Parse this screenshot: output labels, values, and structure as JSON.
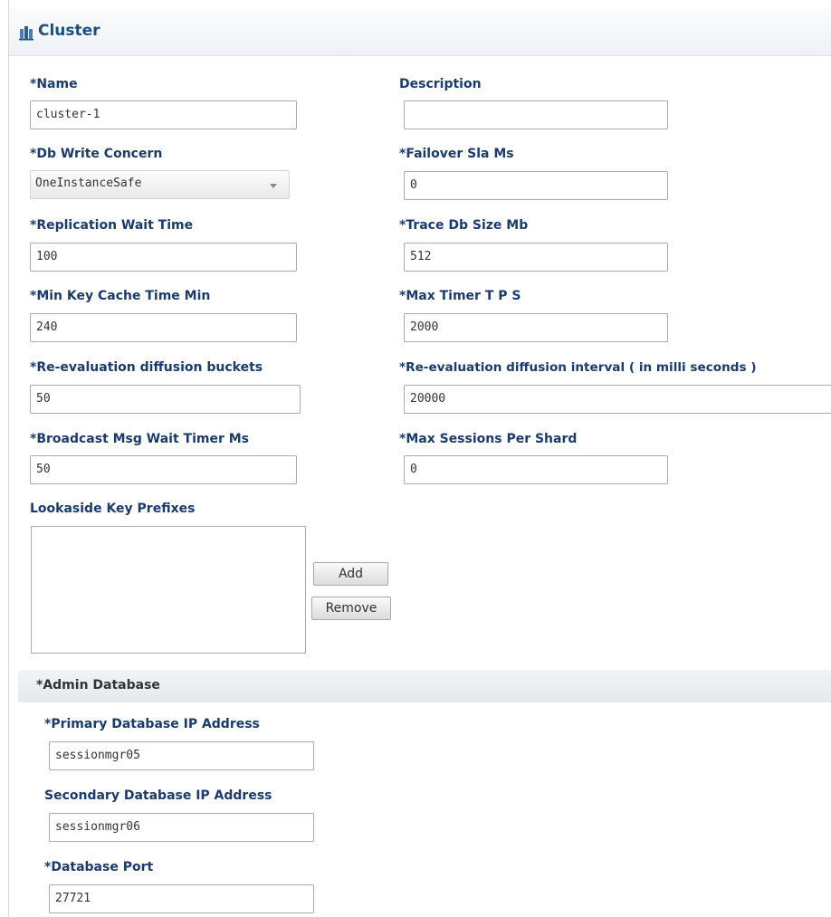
{
  "header": {
    "title": "Cluster"
  },
  "fields": {
    "name": {
      "label": "*Name",
      "value": "cluster-1"
    },
    "description": {
      "label": "Description",
      "value": ""
    },
    "db_write_concern": {
      "label": "*Db Write Concern",
      "value": "OneInstanceSafe"
    },
    "failover_sla_ms": {
      "label": "*Failover Sla Ms",
      "value": "0"
    },
    "replication_wait_time": {
      "label": "*Replication Wait Time",
      "value": "100"
    },
    "trace_db_size_mb": {
      "label": "*Trace Db Size Mb",
      "value": "512"
    },
    "min_key_cache_time_min": {
      "label": "*Min Key Cache Time Min",
      "value": "240"
    },
    "max_timer_tps": {
      "label": "*Max Timer T P S",
      "value": "2000"
    },
    "reeval_diffusion_buckets": {
      "label": "*Re-evaluation diffusion buckets",
      "value": "50"
    },
    "reeval_diffusion_interval": {
      "label": "*Re-evaluation diffusion interval ( in milli seconds )",
      "value": "20000"
    },
    "broadcast_msg_wait_timer_ms": {
      "label": "*Broadcast Msg Wait Timer Ms",
      "value": "50"
    },
    "max_sessions_per_shard": {
      "label": "*Max Sessions Per Shard",
      "value": "0"
    }
  },
  "lookaside": {
    "label": "Lookaside Key Prefixes",
    "items": [],
    "add_label": "Add",
    "remove_label": "Remove"
  },
  "admin_database": {
    "title": "*Admin Database",
    "primary_ip": {
      "label": "*Primary Database IP Address",
      "value": "sessionmgr05"
    },
    "secondary_ip": {
      "label": "Secondary Database IP Address",
      "value": "sessionmgr06"
    },
    "port": {
      "label": "*Database Port",
      "value": "27721"
    }
  },
  "colors": {
    "label": "#1a3b6b",
    "header_title": "#1f4f7c",
    "input_border": "#a9a9a9"
  },
  "icons": {
    "header": "cluster-icon",
    "select": "chevron-down-icon"
  }
}
